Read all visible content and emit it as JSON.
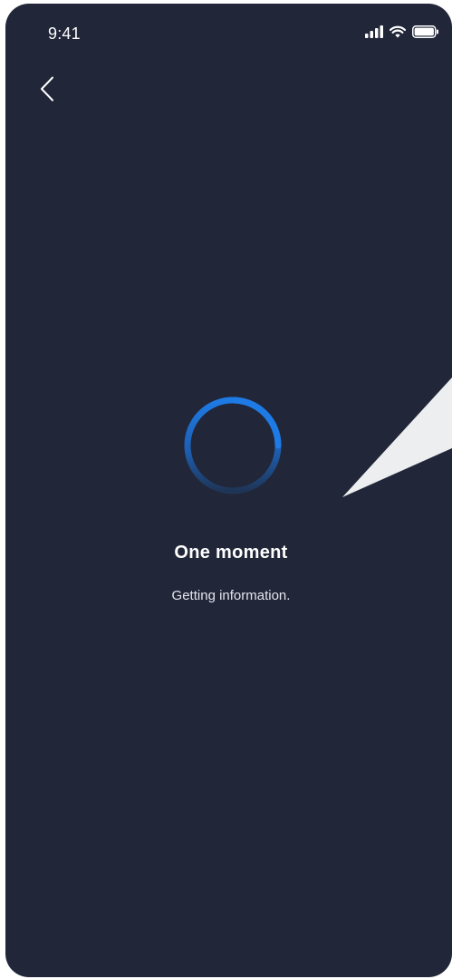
{
  "status_bar": {
    "time": "9:41",
    "icons": [
      "cellular-signal-icon",
      "wifi-icon",
      "battery-icon"
    ]
  },
  "nav": {
    "back_icon": "chevron-left-icon"
  },
  "loading": {
    "spinner_icon": "loading-spinner-icon",
    "title": "One moment",
    "message": "Getting information."
  },
  "colors": {
    "background": "#212638",
    "accent": "#1E7BE6",
    "text_primary": "#FFFFFF",
    "text_secondary": "#E4E6EE"
  }
}
